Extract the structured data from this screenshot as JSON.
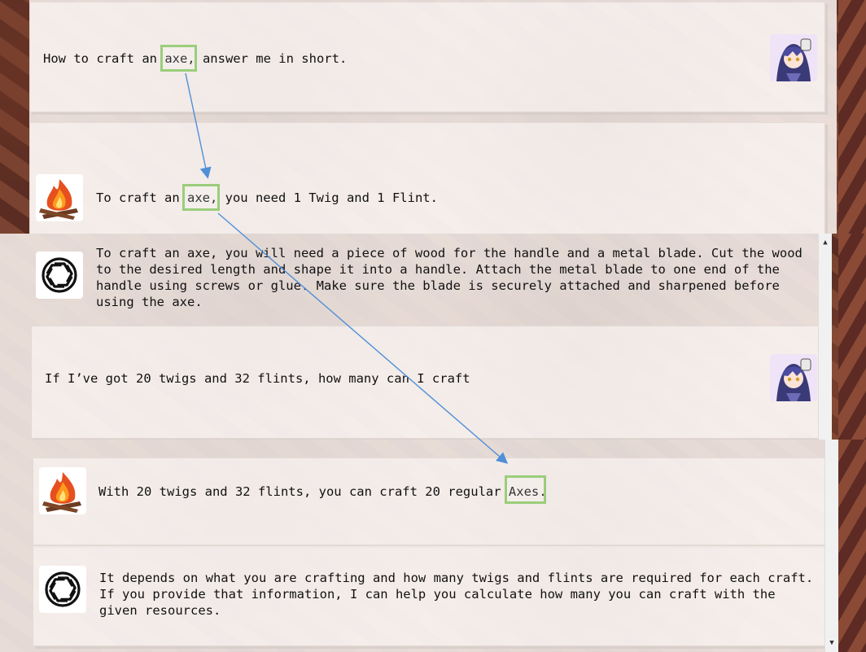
{
  "messages": {
    "user_1": "How to craft an axe, answer me in short.",
    "bot_dst_1_pre": "To craft an ",
    "bot_dst_1_hl": "axe,",
    "bot_dst_1_post": " you need 1 Twig and 1 Flint.",
    "user_1_pre": "How to craft an ",
    "user_1_hl": "axe,",
    "user_1_post": " answer me in short.",
    "bot_gpt_1": "To craft an axe, you will need a piece of wood for the handle and a metal blade. Cut the wood\nto the desired length and shape it into a handle. Attach the metal blade to one end of the\nhandle using screws or glue. Make sure the blade is securely attached and sharpened before\nusing the axe.",
    "user_2": "If I’ve got 20 twigs and 32 flints, how many can I craft",
    "bot_dst_2_pre": "With 20 twigs and 32 flints, you can craft 20 regular ",
    "bot_dst_2_hl": "Axes.",
    "bot_gpt_2": "It depends on what you are crafting and how many twigs and flints are required for each craft.\nIf you provide that information, I can help you calculate how many you can craft with the\ngiven resources."
  },
  "scroll": {
    "up": "▲",
    "down": "▼"
  },
  "colors": {
    "highlight": "#9bcd7b",
    "arrow": "#4f8fd8"
  },
  "icons": [
    "user-avatar-icon",
    "campfire-icon",
    "chatgpt-logo-icon"
  ]
}
